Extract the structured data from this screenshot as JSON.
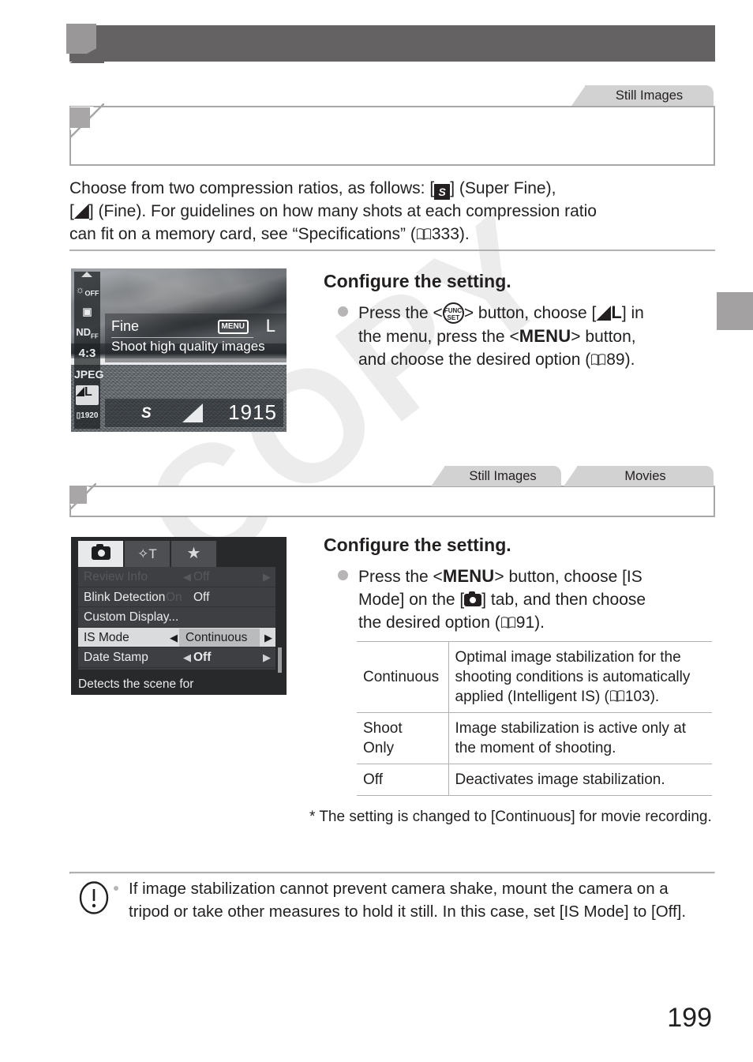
{
  "page": {
    "number": "199",
    "watermark": "COPY"
  },
  "header": {
    "title": ""
  },
  "sections": [
    {
      "id": "compression-ratio",
      "tabs": [
        "Still Images"
      ],
      "heading": "",
      "body_prefix": "Choose from two compression ratios, as follows: [",
      "body_mid1": "] (Super Fine),",
      "body_line2_prefix": "[",
      "body_mid2": "] (Fine). For guidelines on how many shots at each compression ratio",
      "body_line3": "can fit on a memory card, see “Specifications” (",
      "body_ref": "333",
      "body_end": ").",
      "step": {
        "title": "Configure the setting.",
        "line1_a": "Press the <",
        "func_top": "FUNC.",
        "func_bottom": "SET",
        "line1_b": "> button, choose [",
        "quality_letter": "L",
        "line1_c": "] in",
        "line2_a": "the menu, press the <",
        "menu_word": "MENU",
        "line2_b": "> button,",
        "line3_a": "and choose the desired option (",
        "line3_ref": "89",
        "line3_b": ")."
      },
      "screenshot": {
        "name": "live-view-quality-menu",
        "left_icons": [
          "OFF",
          "metering",
          "ND-OFF",
          "4:3",
          "JPEG",
          "L",
          "1920"
        ],
        "selected_left_icon": "L",
        "info_title": "Fine",
        "info_badge": "MENU",
        "info_size": "L",
        "info_desc": "Shoot high quality images",
        "bottom_super_fine": "S",
        "shots_remaining": "1915"
      }
    },
    {
      "id": "image-stabilization",
      "tabs": [
        "Still Images",
        "Movies"
      ],
      "heading": "",
      "step": {
        "title": "Configure the setting.",
        "line1_a": "Press the <",
        "menu_word": "MENU",
        "line1_b": "> button, choose [IS",
        "line2_a": "Mode] on the [",
        "line2_b": "] tab, and then choose",
        "line3_a": "the desired option (",
        "line3_ref": "91",
        "line3_b": ")."
      },
      "screenshot": {
        "name": "camera-menu-is-mode",
        "tabs": [
          "camera-icon",
          "tools-icon",
          "star-icon"
        ],
        "active_tab": "camera-icon",
        "rows": [
          {
            "label": "Review Info",
            "value": "Off",
            "dim": true,
            "selected": false,
            "arrows": true
          },
          {
            "label": "Blink Detection",
            "value_dim": "On",
            "value": "Off",
            "dim": false,
            "selected": false,
            "arrows": false
          },
          {
            "label": "Custom Display...",
            "value": "",
            "dim": false,
            "selected": false,
            "arrows": false
          },
          {
            "label": "IS Mode",
            "value": "Continuous",
            "dim": false,
            "selected": true,
            "arrows": true
          },
          {
            "label": "Date Stamp",
            "value": "Off",
            "dim": false,
            "selected": false,
            "arrows": true
          }
        ],
        "hint": "Detects the scene for"
      },
      "table": {
        "rows": [
          {
            "option": "Continuous",
            "description_a": "Optimal image stabilization for the shooting conditions is automatically applied (Intelligent IS) (",
            "description_ref": "103",
            "description_b": ")."
          },
          {
            "option": "Shoot Only",
            "description_a": "Image stabilization is active only at the moment of shooting.",
            "description_ref": "",
            "description_b": ""
          },
          {
            "option": "Off",
            "description_a": "Deactivates image stabilization.",
            "description_ref": "",
            "description_b": ""
          }
        ]
      },
      "footnote": "* The setting is changed to [Continuous] for movie recording."
    }
  ],
  "caution": {
    "icon": "exclamation-circle-icon",
    "text": "If image stabilization cannot prevent camera shake, mount the camera on a tripod or take other measures to hold it still. In this case, set [IS Mode] to [Off]."
  },
  "colors": {
    "header_bar": "#656263",
    "tab_gray": "#d2d2d2",
    "rule_gray": "#b3b0b1",
    "marker_gray": "#a9a6a7"
  }
}
